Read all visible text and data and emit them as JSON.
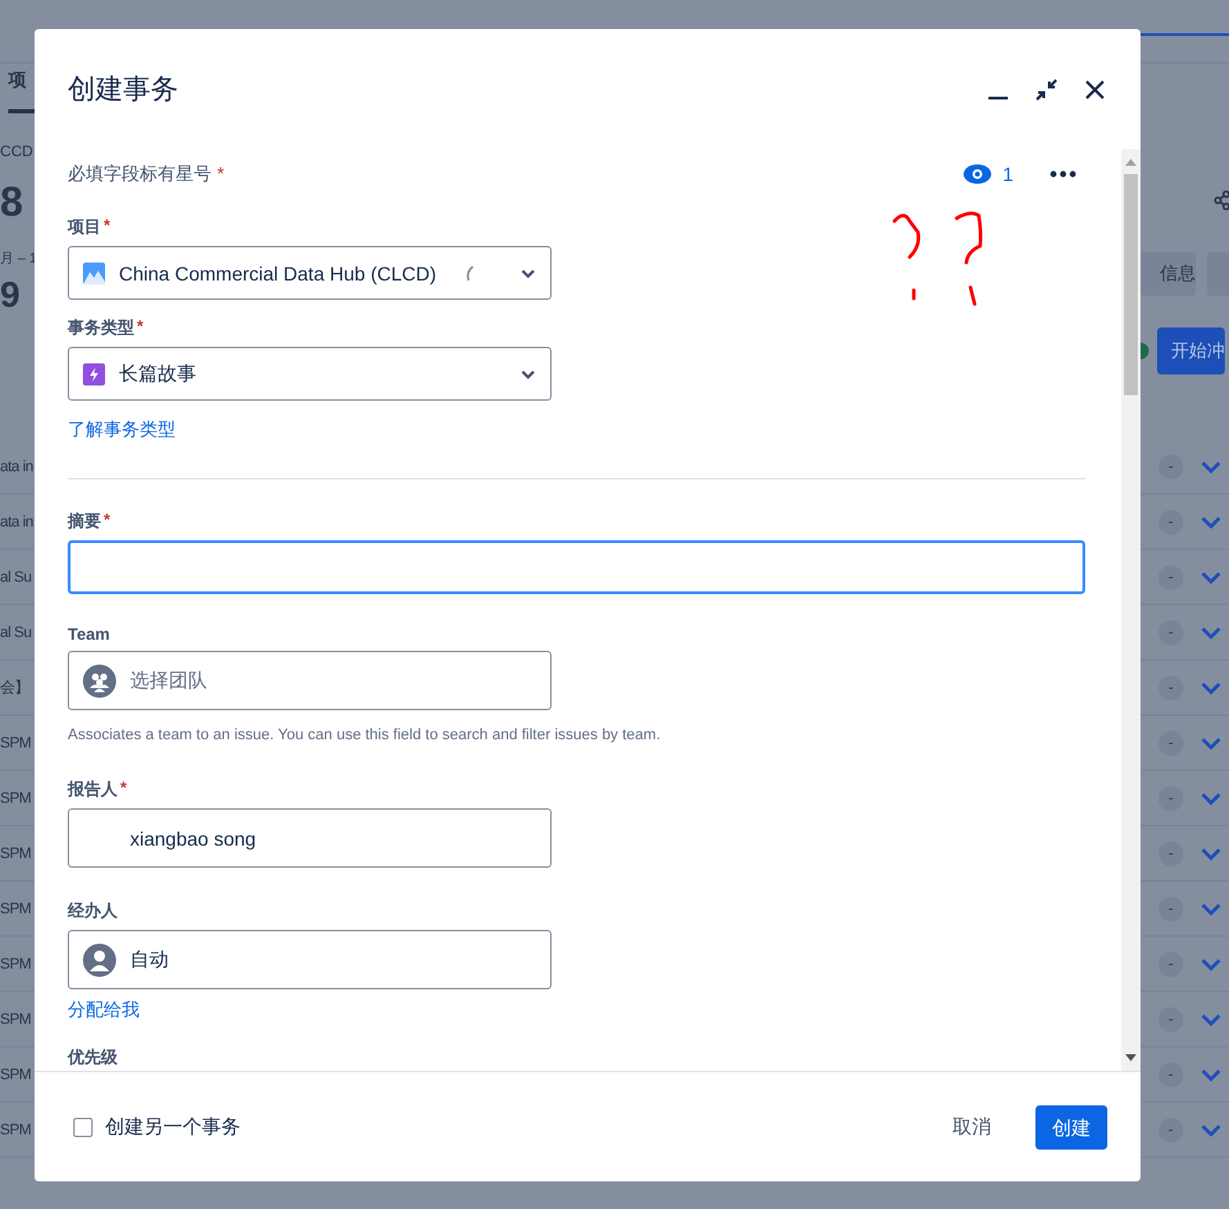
{
  "background": {
    "tab": "项",
    "project_key": "CCD",
    "big_number": "8",
    "date_fragment": "月 – 1",
    "big_digit": "9",
    "info_button": "信息",
    "start_button": "开始冲",
    "rows": [
      {
        "text": "ata in",
        "badge": "-"
      },
      {
        "text": "ata in",
        "badge": "-"
      },
      {
        "text": "al Su",
        "badge": "-"
      },
      {
        "text": "al Su",
        "badge": "-"
      },
      {
        "text": "会】",
        "badge": "-"
      },
      {
        "text": "SPM",
        "badge": "-"
      },
      {
        "text": "SPM",
        "badge": "-"
      },
      {
        "text": "SPM",
        "badge": "-"
      },
      {
        "text": "SPM",
        "badge": "-"
      },
      {
        "text": "SPM",
        "badge": "-"
      },
      {
        "text": "SPM",
        "badge": "-"
      },
      {
        "text": "SPM",
        "badge": "-"
      },
      {
        "text": "SPM",
        "badge": "-"
      }
    ]
  },
  "dialog": {
    "title": "创建事务",
    "required_note": "必填字段标有星号",
    "required_mark": "*",
    "watchers": "1",
    "fields": [
      {
        "kind": "select",
        "label": "项目",
        "required": true,
        "value": "China Commercial Data Hub (CLCD)"
      },
      {
        "kind": "select",
        "label": "事务类型",
        "required": true,
        "value": "长篇故事",
        "link": "了解事务类型"
      },
      {
        "kind": "divider"
      },
      {
        "kind": "text",
        "label": "摘要",
        "required": true,
        "focused": true
      },
      {
        "kind": "picker",
        "label": "Team",
        "required": false,
        "placeholder": "选择团队",
        "helper": "Associates a team to an issue. You can use this field to search and filter issues by team."
      },
      {
        "kind": "picker",
        "label": "报告人",
        "required": true,
        "value": "xiangbao song"
      },
      {
        "kind": "picker",
        "label": "经办人",
        "required": false,
        "value": "自动",
        "link": "分配给我"
      },
      {
        "kind": "heading",
        "label": "优先级",
        "required": false
      }
    ],
    "footer": {
      "create_another": {
        "label": "创建另一个事务",
        "checked": false
      },
      "cancel": "取消",
      "create": "创建"
    }
  }
}
